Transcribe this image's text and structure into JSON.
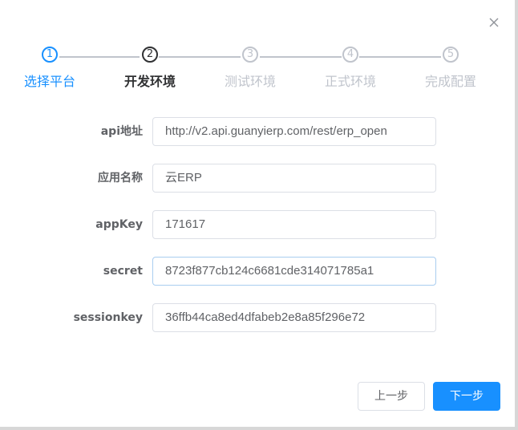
{
  "close_icon": "close-icon",
  "colors": {
    "primary": "#1890ff",
    "active": "#303133",
    "inactive": "#c0c4cc",
    "text": "#606266"
  },
  "steps": [
    {
      "number": "1",
      "label": "选择平台",
      "status": "done"
    },
    {
      "number": "2",
      "label": "开发环境",
      "status": "active"
    },
    {
      "number": "3",
      "label": "测试环境",
      "status": "pending"
    },
    {
      "number": "4",
      "label": "正式环境",
      "status": "pending"
    },
    {
      "number": "5",
      "label": "完成配置",
      "status": "pending"
    }
  ],
  "form": {
    "api_url": {
      "label": "api地址",
      "value": "http://v2.api.guanyierp.com/rest/erp_open"
    },
    "app_name": {
      "label": "应用名称",
      "value": "云ERP"
    },
    "app_key": {
      "label": "appKey",
      "value": "171617"
    },
    "secret": {
      "label": "secret",
      "value": "8723f877cb124c6681cde314071785a1"
    },
    "session_key": {
      "label": "sessionkey",
      "value": "36ffb44ca8ed4dfabeb2e8a85f296e72"
    }
  },
  "buttons": {
    "prev": "上一步",
    "next": "下一步"
  }
}
